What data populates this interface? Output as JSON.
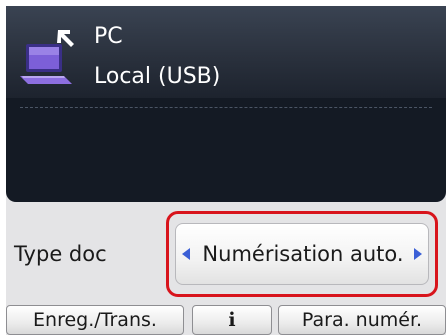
{
  "destination": {
    "name": "PC",
    "connection": "Local (USB)",
    "icon": "laptop-icon"
  },
  "setting": {
    "label": "Type doc",
    "value": "Numérisation auto."
  },
  "function_buttons": {
    "left": "Enreg./Trans.",
    "center": "i",
    "right": "Para. numér."
  },
  "colors": {
    "highlight_border": "#d8141c",
    "arrow": "#3b5fd6",
    "panel_dark": "#141a24"
  }
}
